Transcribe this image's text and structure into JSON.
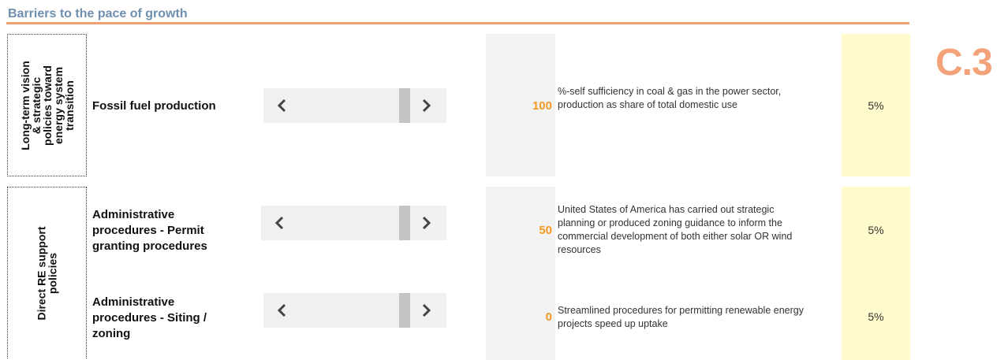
{
  "header": {
    "title": "Barriers to the pace of growth",
    "badge": "C.3"
  },
  "categories": [
    {
      "label": "Long-term vision & strategic policies toward energy system transition",
      "lines": [
        "Long-term vision",
        "& strategic",
        "policies toward",
        "energy system",
        "transition"
      ]
    },
    {
      "label": "Direct RE support policies",
      "lines": [
        "Direct RE support",
        "policies"
      ]
    }
  ],
  "rows": [
    {
      "label_lines": [
        "Fossil fuel production"
      ],
      "score": "100",
      "description": "%-self sufficiency in coal & gas in the power sector, production as share of total domestic use",
      "weight": "5%",
      "slider_position": 0.95
    },
    {
      "label_lines": [
        "Administrative",
        "procedures - Permit",
        "granting procedures"
      ],
      "score": "50",
      "description": "United States of America has carried out strategic planning or produced zoning guidance to inform the commercial development of both either solar OR wind resources",
      "weight": "5%",
      "slider_position": 0.95
    },
    {
      "label_lines": [
        "Administrative",
        "procedures - Siting /",
        "zoning"
      ],
      "score": "0",
      "description": "Streamlined procedures for permitting renewable energy projects speed up uptake",
      "weight": "5%",
      "slider_position": 0.95
    }
  ],
  "colors": {
    "title": "#6f8fae",
    "rule": "#f39d73",
    "badge": "#f4a27a",
    "score": "#f39a22",
    "weight_bg": "#fffbcc",
    "score_bg": "#f2f2f2"
  },
  "icons": {
    "scroll_left": "chevron-left-icon",
    "scroll_right": "chevron-right-icon"
  }
}
